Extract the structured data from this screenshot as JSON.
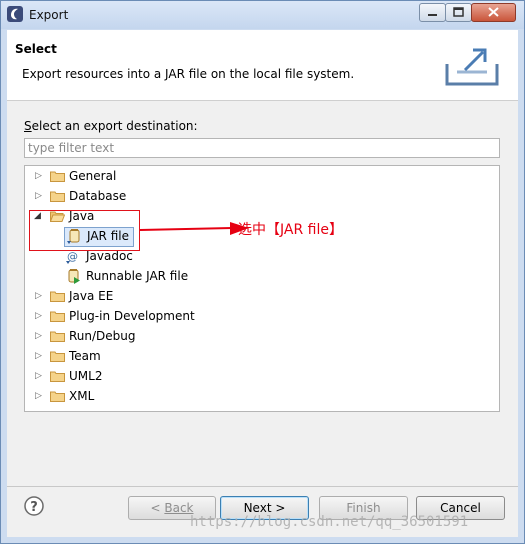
{
  "window": {
    "title": "Export"
  },
  "header": {
    "title": "Select",
    "description": "Export resources into a JAR file on the local file system."
  },
  "destination": {
    "label": "Select an export destination:",
    "filter_placeholder": "type filter text"
  },
  "tree": {
    "items": [
      {
        "label": "General",
        "expanded": false
      },
      {
        "label": "Database",
        "expanded": false
      },
      {
        "label": "Java",
        "expanded": true,
        "children": [
          {
            "label": "JAR file",
            "selected": true,
            "icon": "jar-icon"
          },
          {
            "label": "Javadoc",
            "icon": "javadoc-icon"
          },
          {
            "label": "Runnable JAR file",
            "icon": "runnable-jar-icon"
          }
        ]
      },
      {
        "label": "Java EE",
        "expanded": false
      },
      {
        "label": "Plug-in Development",
        "expanded": false
      },
      {
        "label": "Run/Debug",
        "expanded": false
      },
      {
        "label": "Team",
        "expanded": false
      },
      {
        "label": "UML2",
        "expanded": false
      },
      {
        "label": "XML",
        "expanded": false
      }
    ]
  },
  "annotation": {
    "text": "选中【JAR file】",
    "color": "#e60012"
  },
  "buttons": {
    "back": {
      "prefix": "< ",
      "label": "Back"
    },
    "next": "Next >",
    "finish": "Finish",
    "cancel": "Cancel"
  },
  "watermark": "https://blog.csdn.net/qq_36501591"
}
